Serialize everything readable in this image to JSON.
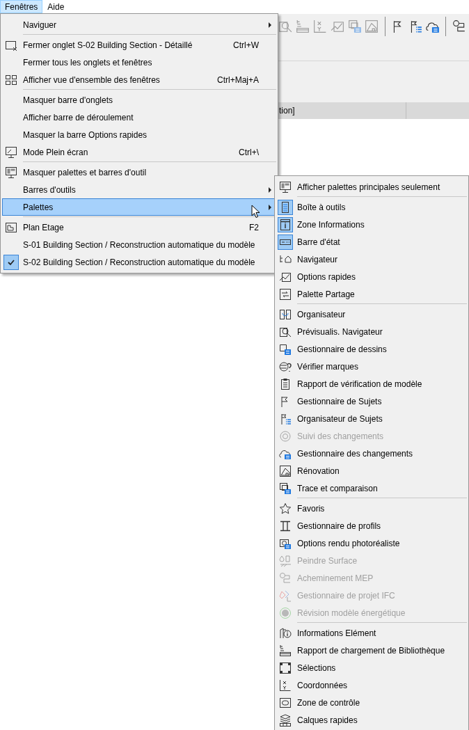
{
  "menubar": [
    {
      "label": "Fenêtres",
      "selected": true
    },
    {
      "label": "Aide",
      "selected": false
    }
  ],
  "document_tab": {
    "title": "tion]"
  },
  "menu": {
    "items": [
      {
        "kind": "item",
        "label": "Naviguer",
        "submenu": true,
        "selected": false,
        "checked": false
      },
      {
        "kind": "separator"
      },
      {
        "kind": "item",
        "label": "Fermer onglet S-02 Building Section - Détaillé",
        "shortcut": "Ctrl+W",
        "selected": false,
        "checked": false
      },
      {
        "kind": "item",
        "label": "Fermer tous les onglets et fenêtres",
        "selected": false,
        "checked": false
      },
      {
        "kind": "item",
        "label": "Afficher vue d'ensemble des fenêtres",
        "shortcut": "Ctrl+Maj+A",
        "selected": false,
        "checked": false
      },
      {
        "kind": "separator"
      },
      {
        "kind": "item",
        "label": "Masquer barre d'onglets",
        "selected": false,
        "checked": false
      },
      {
        "kind": "item",
        "label": "Afficher barre de déroulement",
        "selected": false,
        "checked": false
      },
      {
        "kind": "item",
        "label": "Masquer la barre Options rapides",
        "selected": false,
        "checked": false
      },
      {
        "kind": "item",
        "label": "Mode Plein écran",
        "shortcut": "Ctrl+\\",
        "selected": false,
        "checked": false
      },
      {
        "kind": "separator"
      },
      {
        "kind": "item",
        "label": "Masquer palettes et barres d'outil",
        "selected": false,
        "checked": false
      },
      {
        "kind": "item",
        "label": "Barres d'outils",
        "submenu": true,
        "selected": false,
        "checked": false
      },
      {
        "kind": "item",
        "label": "Palettes",
        "submenu": true,
        "selected": true,
        "checked": false
      },
      {
        "kind": "separator"
      },
      {
        "kind": "item",
        "label": "Plan Etage",
        "shortcut": "F2",
        "selected": false,
        "checked": false
      },
      {
        "kind": "item",
        "label": "S-01 Building Section / Reconstruction automatique du modèle",
        "selected": false,
        "checked": false
      },
      {
        "kind": "item",
        "label": "S-02 Building Section / Reconstruction automatique du modèle",
        "selected": false,
        "checked": true
      }
    ]
  },
  "submenu": {
    "items": [
      {
        "kind": "item",
        "label": "Afficher palettes principales seulement",
        "checked": false,
        "disabled": false
      },
      {
        "kind": "separator"
      },
      {
        "kind": "item",
        "label": "Boîte à outils",
        "checked": true,
        "disabled": false
      },
      {
        "kind": "item",
        "label": "Zone Informations",
        "checked": true,
        "disabled": false
      },
      {
        "kind": "item",
        "label": "Barre d'état",
        "checked": true,
        "disabled": false
      },
      {
        "kind": "item",
        "label": "Navigateur",
        "checked": false,
        "disabled": false
      },
      {
        "kind": "item",
        "label": "Options rapides",
        "checked": false,
        "disabled": false
      },
      {
        "kind": "item",
        "label": "Palette Partage",
        "checked": false,
        "disabled": false
      },
      {
        "kind": "separator"
      },
      {
        "kind": "item",
        "label": "Organisateur",
        "checked": false,
        "disabled": false
      },
      {
        "kind": "item",
        "label": "Prévisualis. Navigateur",
        "checked": false,
        "disabled": false
      },
      {
        "kind": "item",
        "label": "Gestionnaire de dessins",
        "checked": false,
        "disabled": false
      },
      {
        "kind": "item",
        "label": "Vérifier marques",
        "checked": false,
        "disabled": false
      },
      {
        "kind": "item",
        "label": "Rapport de vérification de modèle",
        "checked": false,
        "disabled": false
      },
      {
        "kind": "item",
        "label": "Gestionnaire de Sujets",
        "checked": false,
        "disabled": false
      },
      {
        "kind": "item",
        "label": "Organisateur de Sujets",
        "checked": false,
        "disabled": false
      },
      {
        "kind": "item",
        "label": "Suivi des changements",
        "checked": false,
        "disabled": true
      },
      {
        "kind": "item",
        "label": "Gestionnaire des changements",
        "checked": false,
        "disabled": false
      },
      {
        "kind": "item",
        "label": "Rénovation",
        "checked": false,
        "disabled": false
      },
      {
        "kind": "item",
        "label": "Trace et comparaison",
        "checked": false,
        "disabled": false
      },
      {
        "kind": "separator"
      },
      {
        "kind": "item",
        "label": "Favoris",
        "checked": false,
        "disabled": false
      },
      {
        "kind": "item",
        "label": "Gestionnaire de profils",
        "checked": false,
        "disabled": false
      },
      {
        "kind": "item",
        "label": "Options rendu photoréaliste",
        "checked": false,
        "disabled": false
      },
      {
        "kind": "item",
        "label": "Peindre Surface",
        "checked": false,
        "disabled": true
      },
      {
        "kind": "item",
        "label": "Acheminement MEP",
        "checked": false,
        "disabled": true
      },
      {
        "kind": "item",
        "label": "Gestionnaire de projet IFC",
        "checked": false,
        "disabled": true
      },
      {
        "kind": "item",
        "label": "Révision modèle énergétique",
        "checked": false,
        "disabled": true
      },
      {
        "kind": "separator"
      },
      {
        "kind": "item",
        "label": "Informations Elément",
        "checked": false,
        "disabled": false
      },
      {
        "kind": "item",
        "label": "Rapport de chargement de Bibliothèque",
        "checked": false,
        "disabled": false
      },
      {
        "kind": "item",
        "label": "Sélections",
        "checked": false,
        "disabled": false
      },
      {
        "kind": "item",
        "label": "Coordonnées",
        "checked": false,
        "disabled": false
      },
      {
        "kind": "item",
        "label": "Zone de contrôle",
        "checked": false,
        "disabled": false
      },
      {
        "kind": "item",
        "label": "Calques rapides",
        "checked": false,
        "disabled": false
      }
    ]
  }
}
